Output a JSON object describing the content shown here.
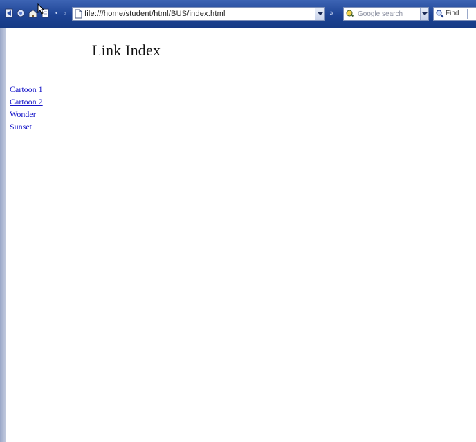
{
  "browser": {
    "address": {
      "url": "file:///home/student/html/BUS/index.html"
    },
    "search": {
      "placeholder": "Google search"
    },
    "find": {
      "label": "Find"
    }
  },
  "page": {
    "heading": "Link Index",
    "links": [
      {
        "label": "Cartoon 1"
      },
      {
        "label": "Cartoon 2"
      },
      {
        "label": "Wonder"
      },
      {
        "label": "Sunset"
      }
    ]
  }
}
